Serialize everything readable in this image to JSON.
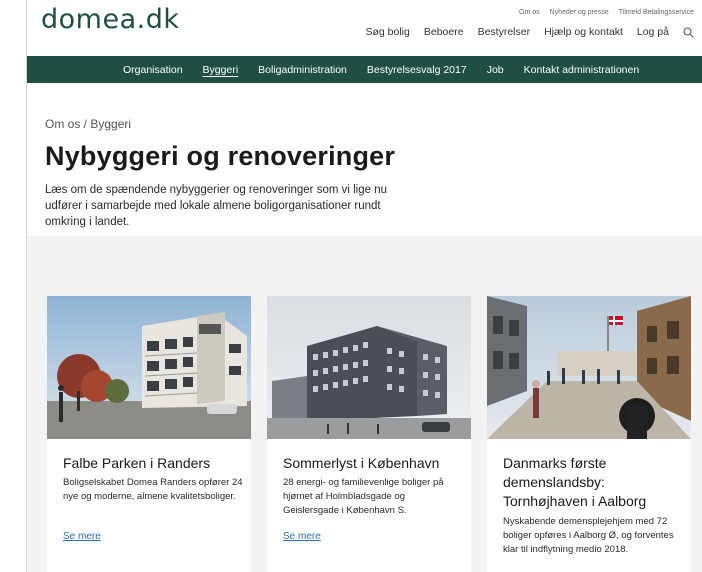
{
  "brand": {
    "logo_text": "domea.dk",
    "green": "#1f4f43",
    "link_color": "#2a6fb0"
  },
  "utility_nav": [
    "Om os",
    "Nyheder og presse",
    "Tilmeld Betalingsservice"
  ],
  "main_nav": [
    "Søg bolig",
    "Beboere",
    "Bestyrelser",
    "Hjælp og kontakt",
    "Log på"
  ],
  "search_icon": "search-icon",
  "section_nav": [
    {
      "label": "Organisation",
      "active": false
    },
    {
      "label": "Byggeri",
      "active": true
    },
    {
      "label": "Boligadministration",
      "active": false
    },
    {
      "label": "Bestyrelsesvalg 2017",
      "active": false
    },
    {
      "label": "Job",
      "active": false
    },
    {
      "label": "Kontakt administrationen",
      "active": false
    }
  ],
  "breadcrumb": "Om os / Byggeri",
  "page_title": "Nybyggeri og renoveringer",
  "intro": "Læs om de spændende nybyggerier og renoveringer som vi lige nu udfører i samarbejde med lokale almene boligorganisationer rundt omkring i landet.",
  "cards": [
    {
      "title": "Falbe Parken i Randers",
      "text": "Boligselskabet Domea Randers opfører 24 nye og moderne, almene kvalitetsboliger.",
      "link": "Se mere"
    },
    {
      "title": "Sommerlyst i København",
      "text": "28 energi- og familievenlige boliger på hjørnet af Holmbladsgade og Geislersgade i København S.",
      "link": "Se mere"
    },
    {
      "title": "Danmarks første demenslandsby: Tornhøjhaven i Aalborg",
      "text": "Nyskabende demensplejehjem med 72 boliger opføres i Aalborg Ø, og forventes klar til indflytning medio 2018.",
      "link": ""
    }
  ]
}
